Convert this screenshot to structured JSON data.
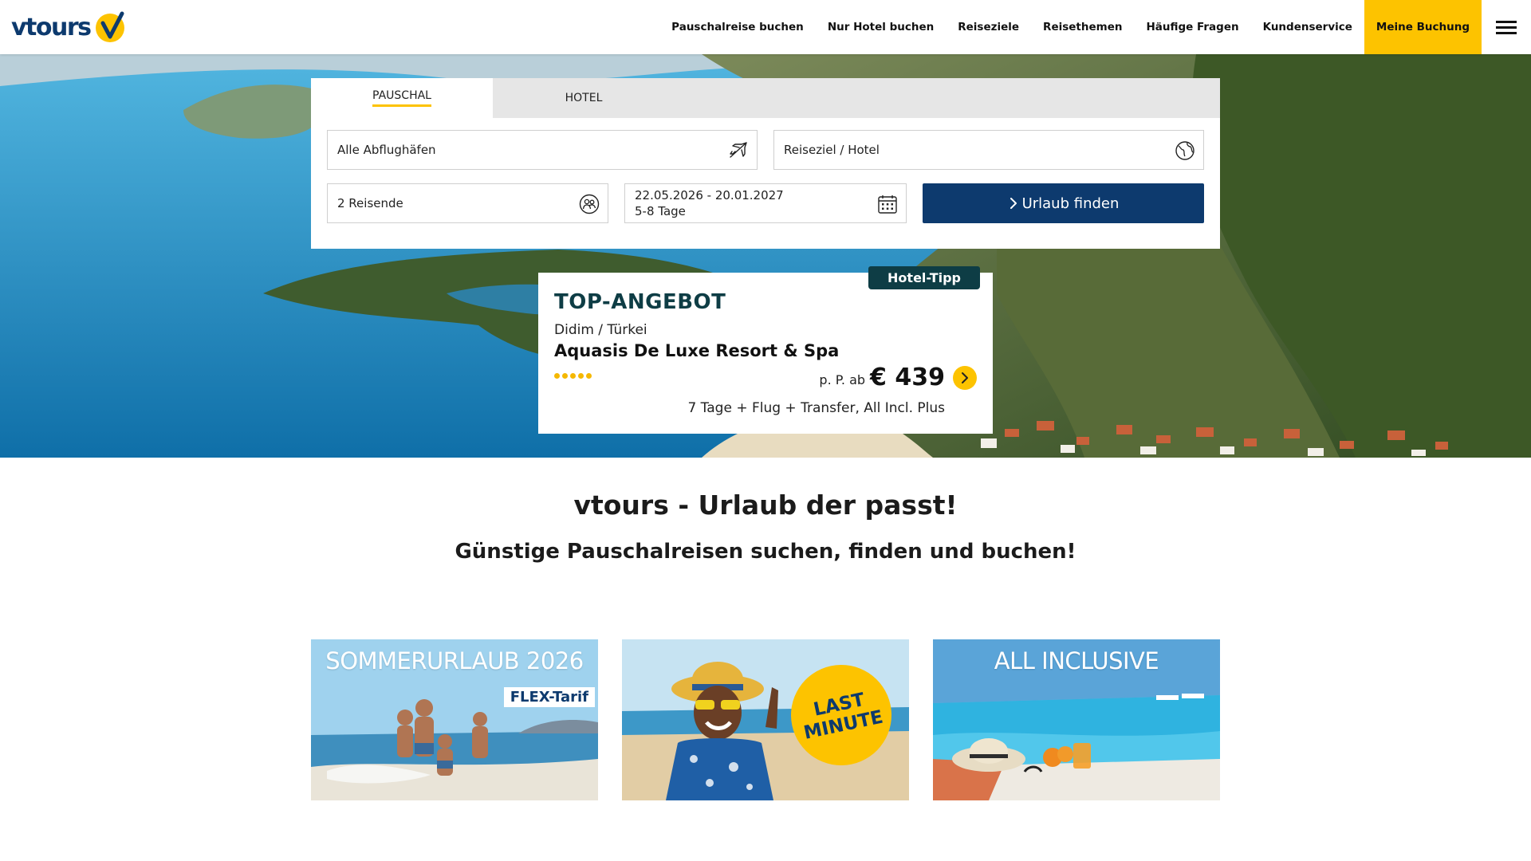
{
  "brand": {
    "name": "vtours",
    "colors": {
      "primary": "#0d3a6e",
      "accent": "#fdc300",
      "dark_teal": "#0e3d45"
    }
  },
  "nav": {
    "items": [
      {
        "label": "Pauschalreise buchen"
      },
      {
        "label": "Nur Hotel buchen"
      },
      {
        "label": "Reiseziele"
      },
      {
        "label": "Reisethemen"
      },
      {
        "label": "Häufige Fragen"
      },
      {
        "label": "Kundenservice"
      },
      {
        "label": "Meine Buchung"
      }
    ],
    "menu_icon": "hamburger-icon"
  },
  "search": {
    "tabs": [
      {
        "label": "PAUSCHAL",
        "active": true
      },
      {
        "label": "HOTEL",
        "active": false
      }
    ],
    "departure": {
      "value": "Alle Abflughäfen",
      "icon": "plane-icon"
    },
    "destination": {
      "value": "Reiseziel / Hotel",
      "icon": "globe-icon"
    },
    "travellers": {
      "value": "2 Reisende",
      "icon": "travellers-icon"
    },
    "dates": {
      "range": "22.05.2026 - 20.01.2027",
      "duration": "5-8 Tage",
      "icon": "calendar-icon"
    },
    "submit": {
      "label": "Urlaub finden",
      "icon": "chevron-right-icon"
    }
  },
  "offer": {
    "badge": "Hotel-Tipp",
    "title": "TOP-ANGEBOT",
    "location": "Didim / Türkei",
    "hotel": "Aquasis De Luxe Resort & Spa",
    "stars": 5,
    "price_prefix": "p. P. ab",
    "price": "€ 439",
    "description": "7 Tage + Flug + Transfer, All Incl. Plus"
  },
  "tagline": {
    "headline": "vtours - Urlaub der passt!",
    "subline": "Günstige Pauschalreisen suchen, finden und buchen!"
  },
  "tiles": [
    {
      "title": "SOMMERURLAUB 2026",
      "badge": "FLEX-Tarif"
    },
    {
      "title": "",
      "badge_line1": "LAST",
      "badge_line2": "MINUTE"
    },
    {
      "title": "ALL INCLUSIVE"
    }
  ]
}
